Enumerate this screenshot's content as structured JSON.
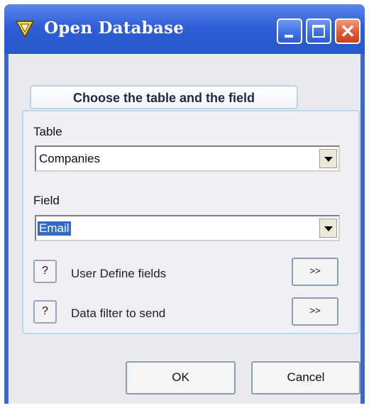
{
  "window": {
    "title": "Open Database",
    "controls": {
      "minimize": "minimize",
      "maximize": "maximize",
      "close": "close"
    }
  },
  "section": {
    "title": "Choose the table and the field"
  },
  "table": {
    "label": "Table",
    "value": "Companies"
  },
  "field": {
    "label": "Field",
    "value": "Email"
  },
  "rows": [
    {
      "help": "?",
      "label": "User Define fields",
      "action": ">>"
    },
    {
      "help": "?",
      "label": "Data filter to send",
      "action": ">>"
    }
  ],
  "buttons": {
    "ok": "OK",
    "cancel": "Cancel"
  },
  "colors": {
    "titlebar": "#2f5ed8",
    "close": "#df5a33",
    "panel": "#e8eaf0",
    "selection": "#316ac5"
  }
}
